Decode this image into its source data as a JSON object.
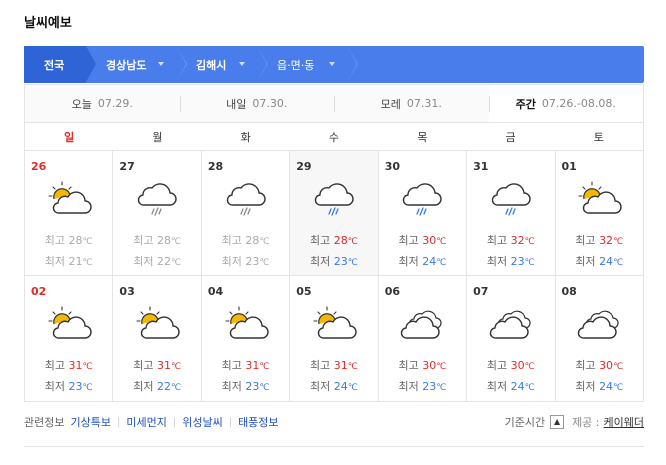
{
  "title": "날씨예보",
  "region": {
    "items": [
      {
        "label": "전국"
      },
      {
        "label": "경상남도"
      },
      {
        "label": "김해시"
      },
      {
        "label": "읍·면·동"
      }
    ]
  },
  "tabs": [
    {
      "label": "오늘",
      "date": "07.29."
    },
    {
      "label": "내일",
      "date": "07.30."
    },
    {
      "label": "모레",
      "date": "07.31."
    },
    {
      "label": "주간",
      "date": "07.26.-08.08.",
      "active": true
    }
  ],
  "weekdays": [
    "일",
    "월",
    "화",
    "수",
    "목",
    "금",
    "토"
  ],
  "temp_labels": {
    "high": "최고",
    "low": "최저",
    "unit": "℃"
  },
  "weeks": [
    [
      {
        "date": "26",
        "icon": "partly-cloudy-icon",
        "high": "28",
        "low": "21",
        "past": true
      },
      {
        "date": "27",
        "icon": "rain-icon",
        "high": "28",
        "low": "22",
        "past": true
      },
      {
        "date": "28",
        "icon": "rain-icon",
        "high": "28",
        "low": "23",
        "past": true
      },
      {
        "date": "29",
        "icon": "rain-icon",
        "high": "28",
        "low": "23",
        "today": true
      },
      {
        "date": "30",
        "icon": "rain-icon",
        "high": "30",
        "low": "24"
      },
      {
        "date": "31",
        "icon": "rain-icon",
        "high": "32",
        "low": "23"
      },
      {
        "date": "01",
        "icon": "partly-cloudy-icon",
        "high": "32",
        "low": "24"
      }
    ],
    [
      {
        "date": "02",
        "icon": "partly-cloudy-icon",
        "high": "31",
        "low": "23"
      },
      {
        "date": "03",
        "icon": "partly-cloudy-icon",
        "high": "31",
        "low": "22"
      },
      {
        "date": "04",
        "icon": "partly-cloudy-icon",
        "high": "31",
        "low": "23"
      },
      {
        "date": "05",
        "icon": "partly-cloudy-icon",
        "high": "31",
        "low": "24"
      },
      {
        "date": "06",
        "icon": "cloudy-icon",
        "high": "30",
        "low": "23"
      },
      {
        "date": "07",
        "icon": "cloudy-icon",
        "high": "30",
        "low": "24"
      },
      {
        "date": "08",
        "icon": "cloudy-icon",
        "high": "30",
        "low": "24"
      }
    ]
  ],
  "footer": {
    "related_label": "관련정보",
    "links": [
      "기상특보",
      "미세먼지",
      "위성날씨",
      "태풍정보"
    ],
    "base_time_label": "기준시간",
    "up_icon": "chevron-up-icon",
    "provider_label": "제공 :",
    "provider": "케이웨더"
  },
  "colors": {
    "region_bg": "#4a7dec",
    "region_first_bg": "#2f64d6",
    "high": "#e02b2b",
    "low": "#3a78e7",
    "sun": "#f5b800"
  }
}
